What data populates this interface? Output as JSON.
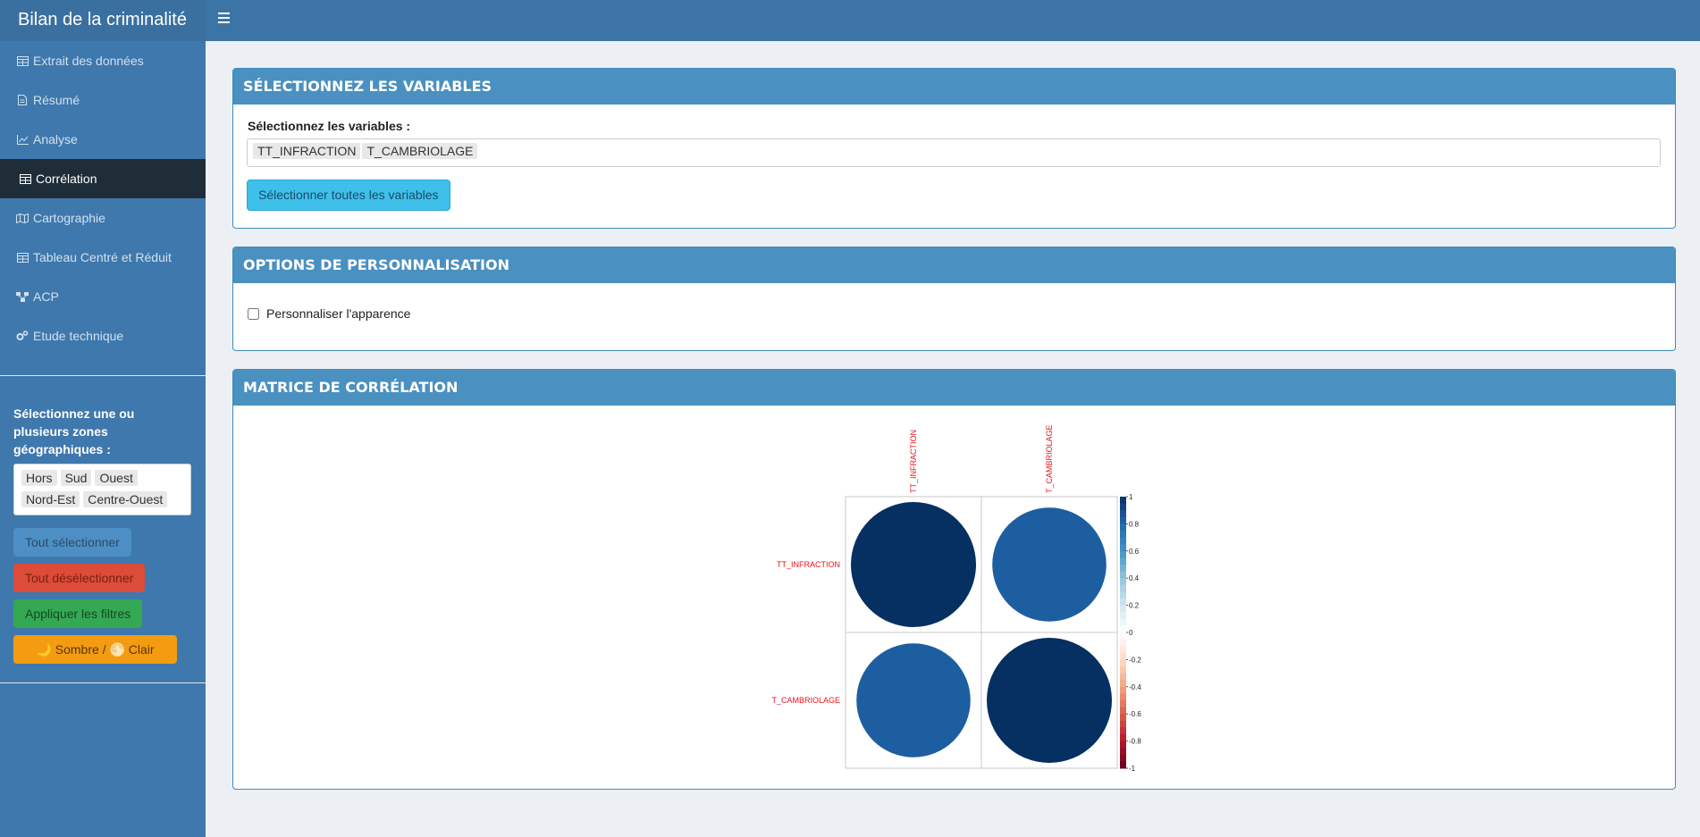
{
  "app": {
    "title": "Bilan de la criminalité"
  },
  "sidebar": {
    "items": [
      {
        "label": "Extrait des données",
        "icon": "table-icon",
        "active": false
      },
      {
        "label": "Résumé",
        "icon": "file-icon",
        "active": false
      },
      {
        "label": "Analyse",
        "icon": "line-chart-icon",
        "active": false
      },
      {
        "label": "Corrélation",
        "icon": "table-icon",
        "active": true
      },
      {
        "label": "Cartographie",
        "icon": "map-icon",
        "active": false
      },
      {
        "label": "Tableau Centré et Réduit",
        "icon": "table-icon",
        "active": false
      },
      {
        "label": "ACP",
        "icon": "sitemap-icon",
        "active": false
      },
      {
        "label": "Etude technique",
        "icon": "cogs-icon",
        "active": false
      }
    ],
    "filter": {
      "label": "Sélectionnez une ou plusieurs zones géographiques :",
      "zones": [
        "Hors",
        "Sud",
        "Ouest",
        "Nord-Est",
        "Centre-Ouest"
      ],
      "select_all": "Tout sélectionner",
      "deselect_all": "Tout désélectionner",
      "apply": "Appliquer les filtres",
      "theme_toggle": "🌙 Sombre / 🌕 Clair"
    }
  },
  "variables_box": {
    "header": "SÉLECTIONNEZ LES VARIABLES",
    "label": "Sélectionnez les variables :",
    "selected": [
      "TT_INFRACTION",
      "T_CAMBRIOLAGE"
    ],
    "select_all_button": "Sélectionner toutes les variables"
  },
  "options_box": {
    "header": "OPTIONS DE PERSONNALISATION",
    "customize_label": "Personnaliser l'apparence",
    "customize_checked": false
  },
  "matrix_box": {
    "header": "MATRICE DE CORRÉLATION"
  },
  "chart_data": {
    "type": "heatmap",
    "variables": [
      "TT_INFRACTION",
      "T_CAMBRIOLAGE"
    ],
    "matrix": [
      [
        1.0,
        0.83
      ],
      [
        0.83,
        1.0
      ]
    ],
    "colorbar_ticks": [
      "1",
      "0.8",
      "0.6",
      "0.4",
      "0.2",
      "0",
      "-0.2",
      "-0.4",
      "-0.6",
      "-0.8",
      "-1"
    ],
    "colorbar_range": [
      -1,
      1
    ],
    "label_color": "#e8141c",
    "positive_color": "#053061",
    "negative_color": "#67001f"
  }
}
